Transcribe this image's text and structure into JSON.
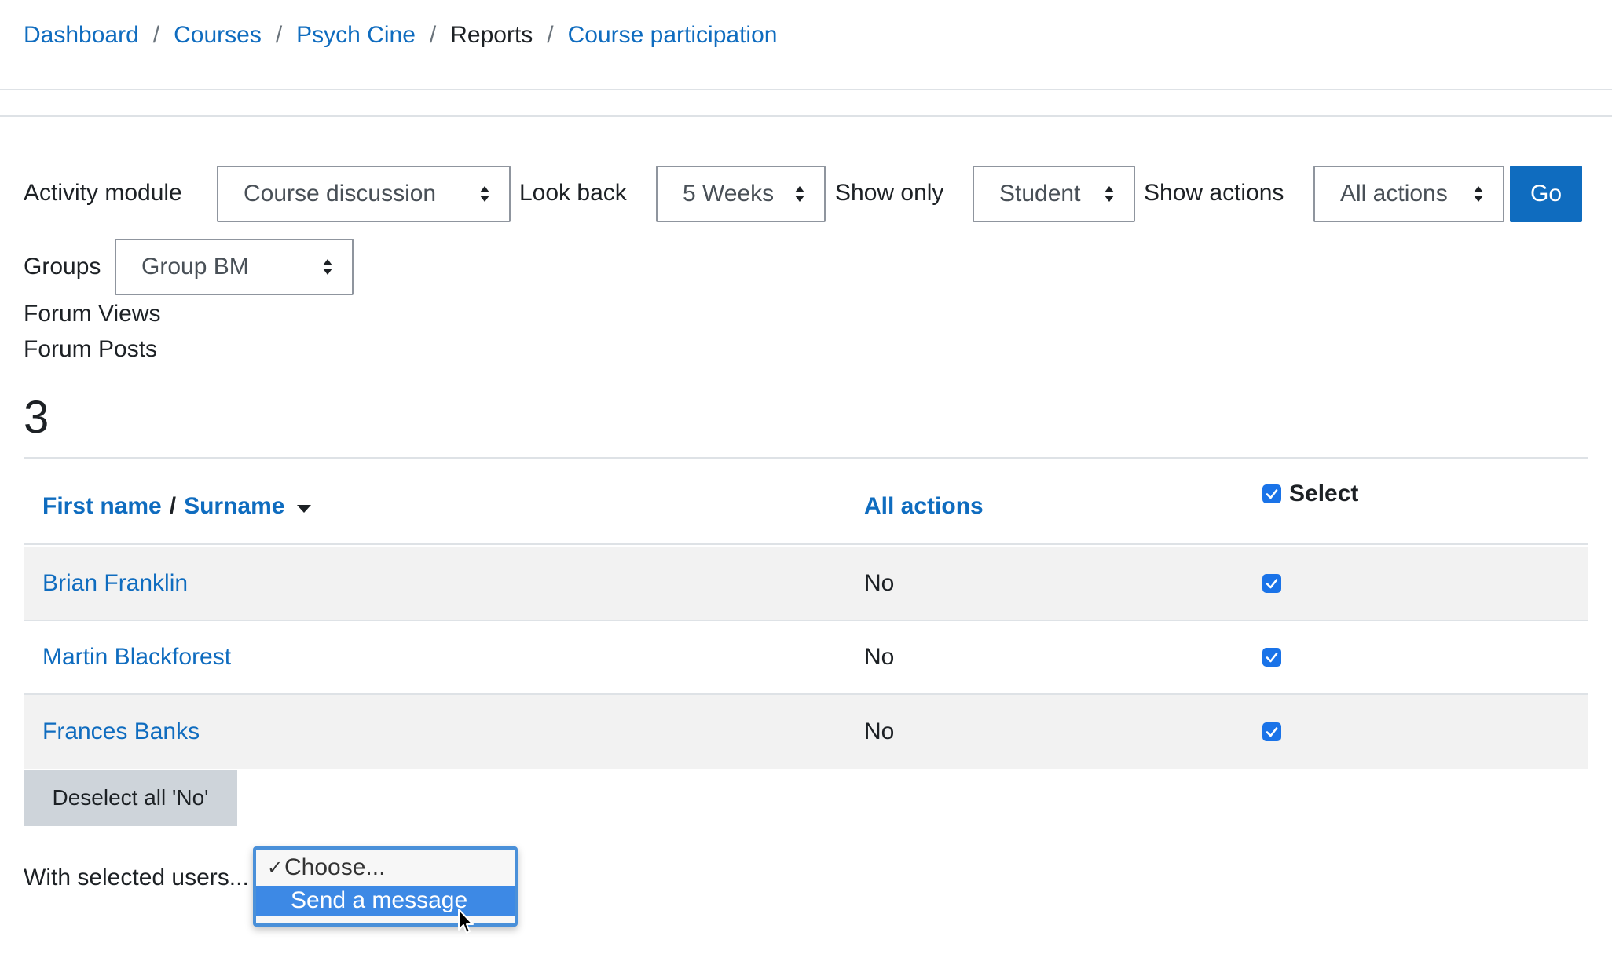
{
  "breadcrumb": {
    "items": [
      "Dashboard",
      "Courses",
      "Psych Cine",
      "Reports",
      "Course participation"
    ],
    "separator": "/"
  },
  "filters": {
    "activity_module": {
      "label": "Activity module",
      "value": "Course discussion"
    },
    "look_back": {
      "label": "Look back",
      "value": "5 Weeks"
    },
    "show_only": {
      "label": "Show only",
      "value": "Student"
    },
    "show_actions": {
      "label": "Show actions",
      "value": "All actions"
    },
    "go_label": "Go",
    "groups": {
      "label": "Groups",
      "value": "Group BM"
    }
  },
  "stats": {
    "lines": [
      "Forum Views",
      "Forum Posts"
    ],
    "count": "3"
  },
  "table": {
    "headers": {
      "first_name": "First name",
      "separator": "/",
      "surname": "Surname",
      "all_actions": "All actions",
      "select": "Select"
    },
    "rows": [
      {
        "name": "Brian Franklin",
        "all_actions": "No",
        "selected": true
      },
      {
        "name": "Martin Blackforest",
        "all_actions": "No",
        "selected": true
      },
      {
        "name": "Frances Banks",
        "all_actions": "No",
        "selected": true
      }
    ]
  },
  "deselect_label": "Deselect all 'No'",
  "bulk": {
    "label": "With selected users...",
    "options": [
      "Choose...",
      "Send a message"
    ],
    "checked_option": "Choose...",
    "highlighted_option": "Send a message"
  },
  "colors": {
    "link": "#0f6cbf",
    "primary_button": "#0f6cbf",
    "checkbox": "#1a73e8",
    "option_highlight": "#3d89e5"
  }
}
